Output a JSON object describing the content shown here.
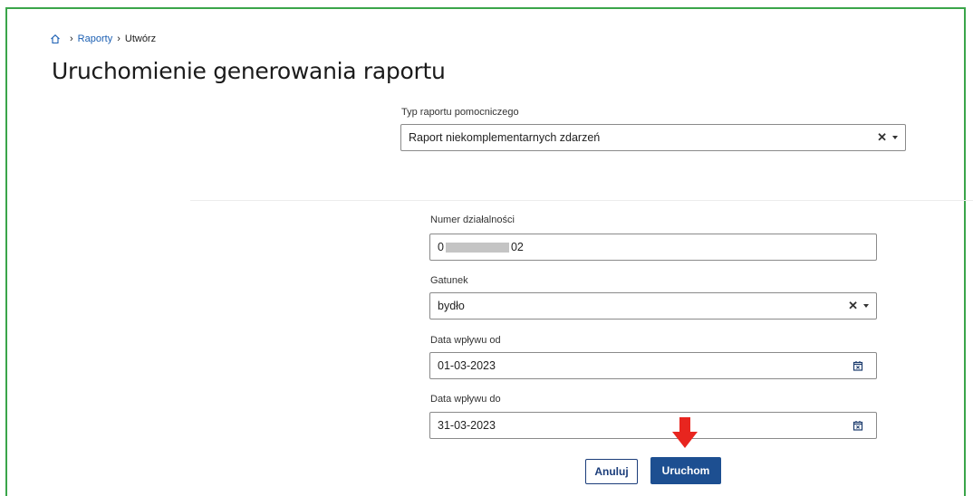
{
  "breadcrumb": {
    "home_icon": "home-icon",
    "items": [
      "Raporty",
      "Utwórz"
    ],
    "separator": "›"
  },
  "page_title": "Uruchomienie generowania raportu",
  "report_type": {
    "label": "Typ raportu pomocniczego",
    "value": "Raport niekomplementarnych zdarzeń"
  },
  "activity_number": {
    "label": "Numer działalności",
    "value_prefix": "0",
    "value_suffix": "02"
  },
  "species": {
    "label": "Gatunek",
    "value": "bydło"
  },
  "date_from": {
    "label": "Data wpływu od",
    "value": "01-03-2023"
  },
  "date_to": {
    "label": "Data wpływu do",
    "value": "31-03-2023"
  },
  "actions": {
    "cancel_label": "Anuluj",
    "run_label": "Uruchom"
  },
  "colors": {
    "frame_border": "#3aa54a",
    "link": "#1b5fb3",
    "primary_button": "#1d4f91",
    "annotation_arrow": "#e8251f"
  },
  "clear_glyph": "✕"
}
